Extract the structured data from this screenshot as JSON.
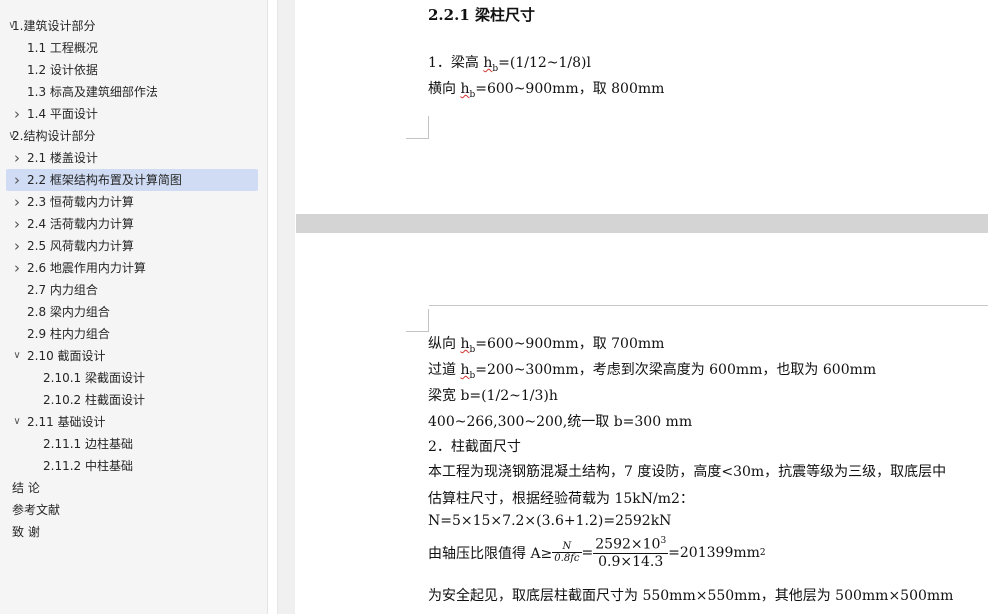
{
  "nav": {
    "items": [
      {
        "label": "1.建筑设计部分",
        "level": 0,
        "chevron": "down"
      },
      {
        "label": "1.1 工程概况",
        "level": 1,
        "chevron": ""
      },
      {
        "label": "1.2 设计依据",
        "level": 1,
        "chevron": ""
      },
      {
        "label": "1.3 标高及建筑细部作法",
        "level": 1,
        "chevron": ""
      },
      {
        "label": "1.4 平面设计",
        "level": 1,
        "chevron": "right"
      },
      {
        "label": "2.结构设计部分",
        "level": 0,
        "chevron": "down"
      },
      {
        "label": "2.1 楼盖设计",
        "level": 1,
        "chevron": "right"
      },
      {
        "label": "2.2 框架结构布置及计算简图",
        "level": 1,
        "chevron": "right",
        "selected": true
      },
      {
        "label": "2.3 恒荷载内力计算",
        "level": 1,
        "chevron": "right"
      },
      {
        "label": "2.4 活荷载内力计算",
        "level": 1,
        "chevron": "right"
      },
      {
        "label": "2.5 风荷载内力计算",
        "level": 1,
        "chevron": "right"
      },
      {
        "label": "2.6 地震作用内力计算",
        "level": 1,
        "chevron": "right"
      },
      {
        "label": "2.7 内力组合",
        "level": 1,
        "chevron": ""
      },
      {
        "label": "2.8 梁内力组合",
        "level": 1,
        "chevron": ""
      },
      {
        "label": "2.9  柱内力组合",
        "level": 1,
        "chevron": ""
      },
      {
        "label": "2.10 截面设计",
        "level": 1,
        "chevron": "down"
      },
      {
        "label": "2.10.1 梁截面设计",
        "level": 2,
        "chevron": ""
      },
      {
        "label": "2.10.2 柱截面设计",
        "level": 2,
        "chevron": ""
      },
      {
        "label": "2.11 基础设计",
        "level": 1,
        "chevron": "down"
      },
      {
        "label": "2.11.1 边柱基础",
        "level": 2,
        "chevron": ""
      },
      {
        "label": "2.11.2 中柱基础",
        "level": 2,
        "chevron": ""
      },
      {
        "label": "结  论",
        "level": 0,
        "chevron": ""
      },
      {
        "label": "参考文献",
        "level": 0,
        "chevron": ""
      },
      {
        "label": "致  谢",
        "level": 0,
        "chevron": ""
      }
    ]
  },
  "page1": {
    "heading": "2.2.1 梁柱尺寸",
    "line1_prefix": "1．梁高  ",
    "line1_h": "h",
    "line1_sub": "b",
    "line1_suffix": "=(1/12~1/8)l",
    "line2_prefix": "横向  ",
    "line2_h": "h",
    "line2_sub": "b",
    "line2_suffix": "=600~900mm，取 800mm"
  },
  "page2": {
    "l1_prefix": "纵向  ",
    "l1_h": "h",
    "l1_sub": "b",
    "l1_suffix": "=600~900mm，取 700mm",
    "l2_prefix": "过道  ",
    "l2_h": "h",
    "l2_sub": "b",
    "l2_suffix": "=200~300mm，考虑到次梁高度为 600mm，也取为 600mm",
    "l3": "梁宽  b=(1/2~1/3)h",
    "l4": "400~266,300~200,统一取 b=300 mm",
    "l5": "2．柱截面尺寸",
    "l6": "本工程为现浇钢筋混凝土结构，7 度设防，高度<30m，抗震等级为三级，取底层中",
    "l7": "估算柱尺寸，根据经验荷载为 15kN/m2：",
    "l8": "N=5×15×7.2×(3.6+1.2)=2592kN",
    "l9_prefix": "由轴压比限值得 A≥",
    "l9_frac1_num": "N",
    "l9_frac1_den": "0.8fc",
    "l9_eq": "=",
    "l9_frac2_num": "2592×10",
    "l9_frac2_num_sup": "3",
    "l9_frac2_den": "0.9×14.3",
    "l9_result": "=201399mm",
    "l9_result_sup": "2",
    "l10": "为安全起见，取底层柱截面尺寸为 550mm×550mm，其他层为 500mm×500mm"
  }
}
